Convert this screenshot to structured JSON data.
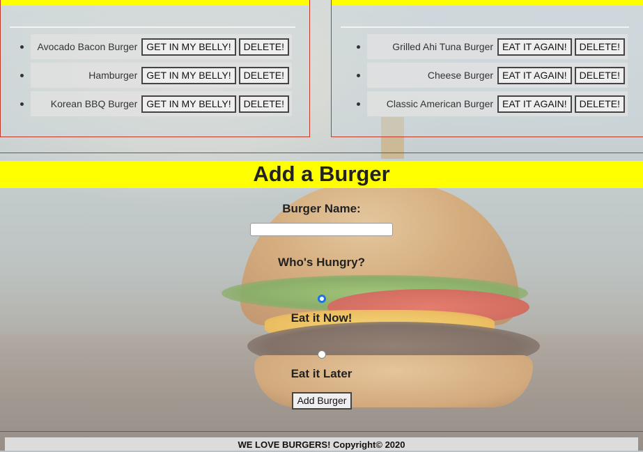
{
  "left_panel": {
    "items": [
      {
        "name": "Avocado Bacon Burger",
        "action": "GET IN MY BELLY!",
        "delete": "DELETE!"
      },
      {
        "name": "Hamburger",
        "action": "GET IN MY BELLY!",
        "delete": "DELETE!"
      },
      {
        "name": "Korean BBQ Burger",
        "action": "GET IN MY BELLY!",
        "delete": "DELETE!"
      }
    ]
  },
  "right_panel": {
    "items": [
      {
        "name": "Grilled Ahi Tuna Burger",
        "action": "EAT IT AGAIN!",
        "delete": "DELETE!"
      },
      {
        "name": "Cheese Burger",
        "action": "EAT IT AGAIN!",
        "delete": "DELETE!"
      },
      {
        "name": "Classic American Burger",
        "action": "EAT IT AGAIN!",
        "delete": "DELETE!"
      }
    ]
  },
  "add_form": {
    "title": "Add a Burger",
    "name_label": "Burger Name:",
    "name_value": "",
    "hungry_label": "Who's Hungry?",
    "option_now": "Eat it Now!",
    "option_later": "Eat it Later",
    "selected_option": "now",
    "submit_label": "Add Burger"
  },
  "footer": {
    "text": "WE LOVE BURGERS! Copyright© 2020"
  },
  "colors": {
    "header_yellow": "#ffff00",
    "border_red": "#c0392b",
    "radio_blue": "#1a73e8"
  }
}
